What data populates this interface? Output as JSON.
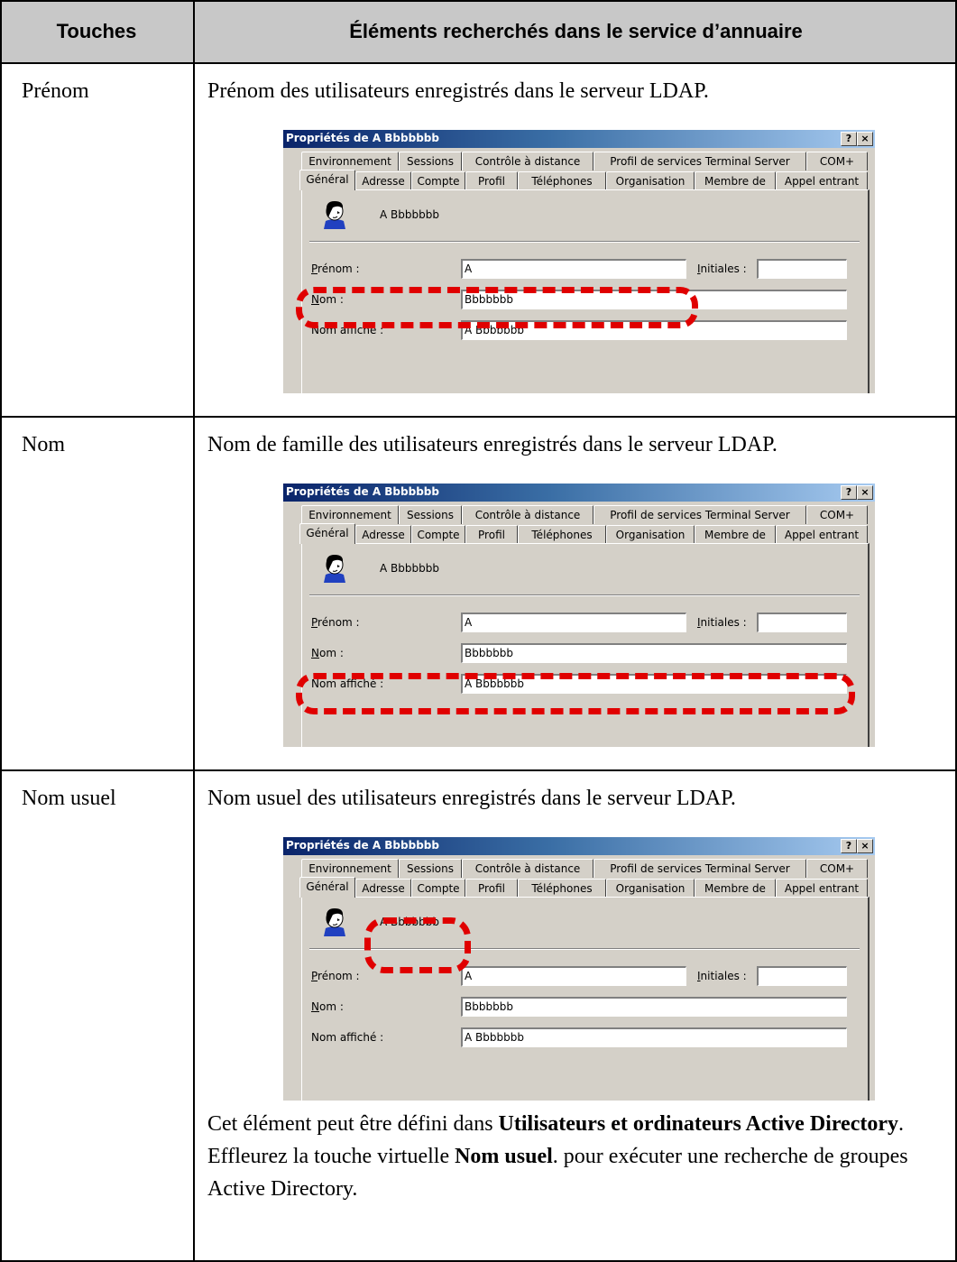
{
  "table": {
    "headers": {
      "keys": "Touches",
      "elements": "Éléments recherchés dans le service d’annuaire"
    },
    "rows": [
      {
        "key": "Prénom",
        "description": "Prénom des utilisateurs enregistrés dans le serveur LDAP.",
        "highlight": "first-name"
      },
      {
        "key": "Nom",
        "description": "Nom de famille des utilisateurs enregistrés dans le serveur LDAP.",
        "highlight": "last-name"
      },
      {
        "key": "Nom usuel",
        "description": "Nom usuel des utilisateurs enregistrés dans le serveur LDAP.",
        "highlight": "display-name"
      }
    ],
    "note": {
      "line1_a": "Cet élément peut être défini dans ",
      "line1_b": "Utilisateurs et ordinateurs Active Directory",
      "line1_c": ".",
      "line2_a": "Effleurez la touche virtuelle ",
      "line2_b": "Nom usuel",
      "line2_c": ". pour exécuter une recherche de groupes Active Directory."
    }
  },
  "dialog": {
    "title": "Propriétés de A Bbbbbbb",
    "help_button": "?",
    "close_button": "×",
    "tabs_row1": [
      "Environnement",
      "Sessions",
      "Contrôle à distance",
      "Profil de services Terminal Server",
      "COM+"
    ],
    "tabs_row2": [
      "Général",
      "Adresse",
      "Compte",
      "Profil",
      "Téléphones",
      "Organisation",
      "Membre de",
      "Appel entrant"
    ],
    "display_name": "A Bbbbbbb",
    "labels": {
      "first_name": "Prénom :",
      "initials": "Initiales :",
      "last_name": "Nom :",
      "display_name": "Nom affiché :"
    },
    "values": {
      "first_name": "A",
      "initials": "",
      "last_name": "Bbbbbbb",
      "display_name": "A Bbbbbbb"
    }
  },
  "colors": {
    "header_bg": "#c8c8c8",
    "highlight": "#e00000",
    "dialog_bg": "#d4d0c8",
    "title_start": "#0a246a",
    "title_end": "#a6caf0"
  }
}
